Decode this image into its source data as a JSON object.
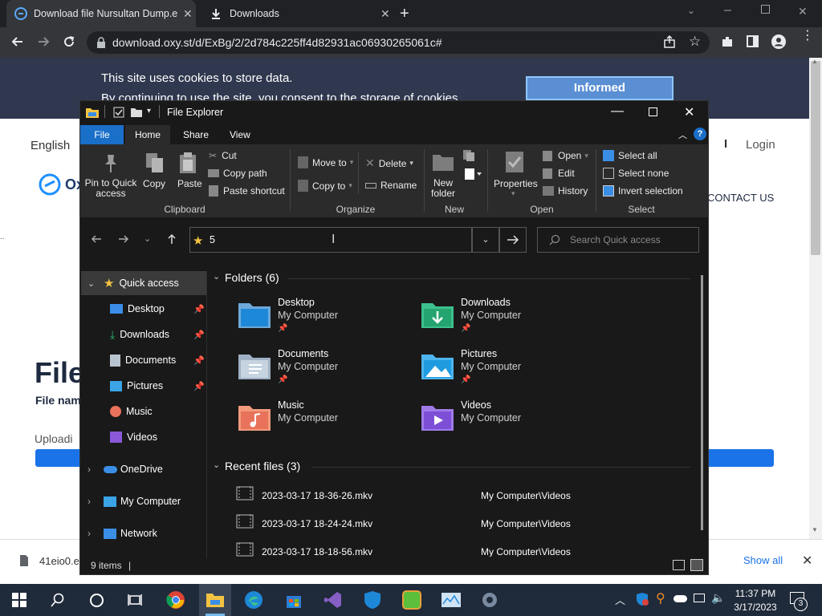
{
  "browser": {
    "tabs": [
      {
        "title": "Download file Nursultan Dump.e"
      },
      {
        "title": "Downloads"
      }
    ],
    "url": "download.oxy.st/d/ExBg/2/2d784c225ff4d82931ac06930265061c#"
  },
  "page": {
    "cookie_line1": "This site uses cookies to store data.",
    "cookie_line2": "By continuing to use the site, you consent to the storage of cookies.",
    "cookie_button": "Informed",
    "lang": "English",
    "login": "Login",
    "contact": "CONTACT US",
    "logo_text": "Ox",
    "heading": "File",
    "file_name_label": "File nam",
    "uploading": "Uploadi"
  },
  "download_bar": {
    "file": "41eio0.e",
    "show_all": "Show all"
  },
  "explorer": {
    "title": "File Explorer",
    "tabs": [
      "File",
      "Home",
      "Share",
      "View"
    ],
    "ribbon": {
      "clipboard": {
        "pin": "Pin to Quick access",
        "copy": "Copy",
        "paste": "Paste",
        "cut": "Cut",
        "copy_path": "Copy path",
        "paste_shortcut": "Paste shortcut",
        "group": "Clipboard"
      },
      "organize": {
        "move_to": "Move to",
        "copy_to": "Copy to",
        "delete": "Delete",
        "rename": "Rename",
        "group": "Organize"
      },
      "new": {
        "new_folder": "New folder",
        "group": "New"
      },
      "open": {
        "properties": "Properties",
        "open": "Open",
        "edit": "Edit",
        "history": "History",
        "group": "Open"
      },
      "select": {
        "select_all": "Select all",
        "select_none": "Select none",
        "invert": "Invert selection",
        "group": "Select"
      }
    },
    "address": "5",
    "search_placeholder": "Search Quick access",
    "nav": {
      "quick_access": "Quick access",
      "pinned": [
        "Desktop",
        "Downloads",
        "Documents",
        "Pictures"
      ],
      "others": [
        "Music",
        "Videos"
      ],
      "onedrive": "OneDrive",
      "my_computer": "My Computer",
      "network": "Network"
    },
    "folders_header": "Folders (6)",
    "folders": [
      {
        "name": "Desktop",
        "location": "My Computer"
      },
      {
        "name": "Downloads",
        "location": "My Computer"
      },
      {
        "name": "Documents",
        "location": "My Computer"
      },
      {
        "name": "Pictures",
        "location": "My Computer"
      },
      {
        "name": "Music",
        "location": "My Computer"
      },
      {
        "name": "Videos",
        "location": "My Computer"
      }
    ],
    "recent_header": "Recent files (3)",
    "recent": [
      {
        "name": "2023-03-17 18-36-26.mkv",
        "path": "My Computer\\Videos"
      },
      {
        "name": "2023-03-17 18-24-24.mkv",
        "path": "My Computer\\Videos"
      },
      {
        "name": "2023-03-17 18-18-56.mkv",
        "path": "My Computer\\Videos"
      }
    ],
    "status": "9 items"
  },
  "taskbar": {
    "time": "11:37 PM",
    "date": "3/17/2023",
    "notif_count": "3"
  }
}
